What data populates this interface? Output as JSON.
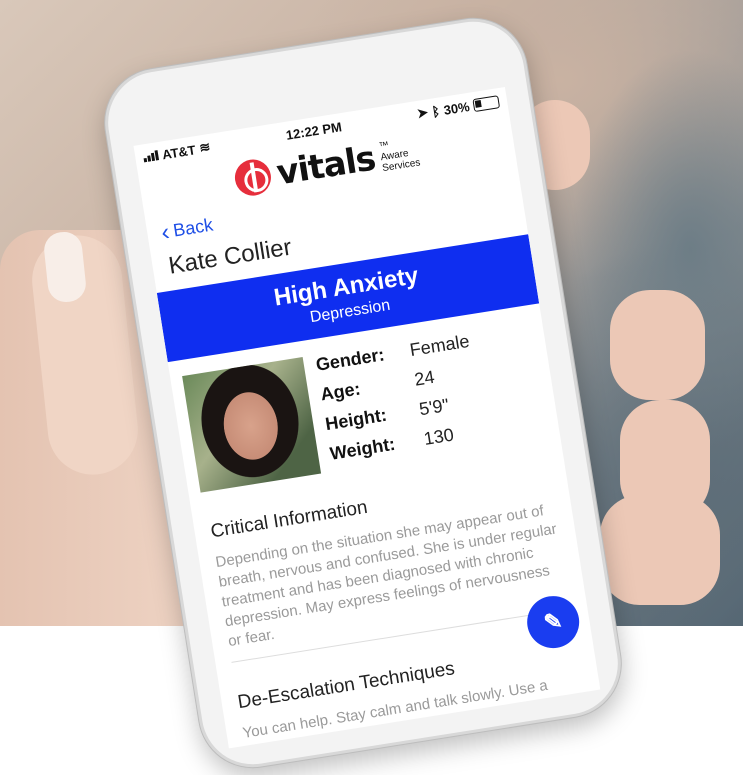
{
  "status": {
    "carrier": "AT&T",
    "time": "12:22 PM",
    "battery": "30%"
  },
  "brand": {
    "name": "vitals",
    "tagline_line1": "Aware",
    "tagline_line2": "Services",
    "trademark": "™"
  },
  "nav": {
    "back_label": "Back"
  },
  "patient": {
    "name": "Kate Collier",
    "condition_primary": "High Anxiety",
    "condition_secondary": "Depression",
    "fields": [
      {
        "label": "Gender:",
        "value": "Female"
      },
      {
        "label": "Age:",
        "value": "24"
      },
      {
        "label": "Height:",
        "value": "5'9\""
      },
      {
        "label": "Weight:",
        "value": "130"
      }
    ]
  },
  "sections": {
    "critical_title": "Critical Information",
    "critical_text": "Depending on the situation she may appear out of breath, nervous and confused. She is under regular treatment and has been diagnosed with chronic depression. May express feelings of nervousness or fear.",
    "deescalation_title": "De-Escalation Techniques",
    "deescalation_text": "You can help. Stay calm and talk slowly. Use a quiet but gentle, caring voice. Avoid"
  },
  "fab": {
    "icon": "pencil-icon"
  },
  "colors": {
    "accent_blue": "#0f2ef0",
    "brand_red": "#e62e3c"
  }
}
